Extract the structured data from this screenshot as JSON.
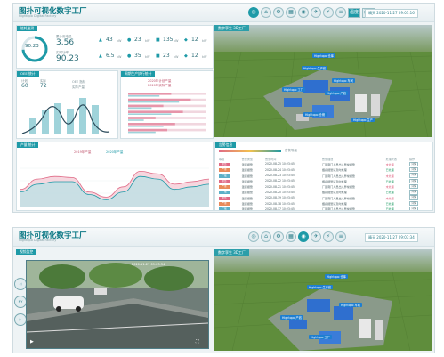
{
  "dashboard": {
    "title": "图扑可视化数字工厂",
    "subtitle": "Hightopo Digital Factory",
    "toolbar": [
      "◎",
      "⌂",
      "⚙",
      "▦",
      "◉",
      "✈",
      "⚡",
      "≡"
    ],
    "toolbar_extra": [
      "温度",
      "湿度"
    ],
    "weather": "晴天  2020-11-27 09:01:16",
    "panels": {
      "energy": {
        "title": "能耗监测",
        "total_label": "总功率/千瓦",
        "gauge_value": "90.23",
        "val1": "3.56",
        "val2": "90.23",
        "label1": "累计用电量",
        "label2": "实时功率",
        "stats": [
          {
            "icon": "▲",
            "value": "43",
            "unit": "kW"
          },
          {
            "icon": "●",
            "value": "23",
            "unit": "kW"
          },
          {
            "icon": "■",
            "value": "135",
            "unit": "kW"
          },
          {
            "icon": "◆",
            "value": "12",
            "unit": "kW"
          },
          {
            "icon": "▲",
            "value": "6.5",
            "unit": "kW"
          },
          {
            "icon": "●",
            "value": "35",
            "unit": "kW"
          },
          {
            "icon": "■",
            "value": "23",
            "unit": "kW"
          },
          {
            "icon": "◆",
            "value": "12",
            "unit": "kW"
          }
        ]
      },
      "oee": {
        "title": "OEE 统计",
        "v1": "60",
        "v2": "72",
        "l1": "计划",
        "l2": "实际",
        "legend": [
          "OEE 指标",
          "实际产量"
        ]
      },
      "production": {
        "title": "周期生产执行统计",
        "legend": [
          "2020年计划产量",
          "2020年实际产量"
        ],
        "bars": [
          0.55,
          0.8,
          0.45,
          0.7,
          0.35,
          0.6,
          0.5
        ]
      },
      "trend": {
        "title": "产量 统计",
        "legend": [
          "2019年产量",
          "2020年产量"
        ],
        "chart_data": {
          "type": "area",
          "series": [
            {
              "name": "2019年产量",
              "values": [
                0.35,
                0.55,
                0.6,
                0.58,
                0.3,
                0.2,
                0.4,
                0.7,
                0.65,
                0.45,
                0.5,
                0.55
              ]
            },
            {
              "name": "2020年产量",
              "values": [
                0.3,
                0.45,
                0.5,
                0.5,
                0.25,
                0.15,
                0.3,
                0.6,
                0.55,
                0.35,
                0.4,
                0.45
              ]
            }
          ]
        }
      },
      "map": {
        "title": "数字孪生 3D工厂",
        "tags": [
          "Hightopo 生产线",
          "Hightopo 仓库",
          "Hightopo 车间",
          "Hightopo 产线",
          "Hightopo 工厂",
          "Hightopo 仓储",
          "Hightopo 生产"
        ]
      },
      "events": {
        "title": "告警信息",
        "filter_label": "告警等级",
        "headers": [
          "等级",
          "告警类型",
          "告警时间",
          "告警描述",
          "处理状态",
          "操作"
        ],
        "rows": [
          {
            "level": "紧急",
            "type": "温度报警",
            "time": "2020-08-25 10:23:45",
            "desc": "厂区南门人员出入异常报警",
            "status": "未处理",
            "op": "详情"
          },
          {
            "level": "严重",
            "type": "温度报警",
            "time": "2020-08-24 10:23:45",
            "desc": "烟感报警请及时处理",
            "status": "已处理",
            "op": "详情"
          },
          {
            "level": "一般",
            "type": "温度报警",
            "time": "2020-08-23 10:23:45",
            "desc": "厂区南门人员出入异常报警",
            "status": "未处理",
            "op": "详情"
          },
          {
            "level": "紧急",
            "type": "温度报警",
            "time": "2020-08-22 10:23:45",
            "desc": "烟感报警请及时处理",
            "status": "已处理",
            "op": "详情"
          },
          {
            "level": "严重",
            "type": "温度报警",
            "time": "2020-08-21 10:23:45",
            "desc": "厂区南门人员出入异常报警",
            "status": "未处理",
            "op": "详情"
          },
          {
            "level": "一般",
            "type": "温度报警",
            "time": "2020-08-20 10:23:45",
            "desc": "烟感报警请及时处理",
            "status": "已处理",
            "op": "详情"
          },
          {
            "level": "紧急",
            "type": "温度报警",
            "time": "2020-08-19 10:23:45",
            "desc": "厂区南门人员出入异常报警",
            "status": "未处理",
            "op": "详情"
          },
          {
            "level": "严重",
            "type": "温度报警",
            "time": "2020-08-18 10:23:45",
            "desc": "烟感报警请及时处理",
            "status": "已处理",
            "op": "详情"
          },
          {
            "level": "一般",
            "type": "温度报警",
            "time": "2020-08-17 10:23:45",
            "desc": "厂区南门人员出入异常报警",
            "status": "已处理",
            "op": "详情"
          }
        ]
      }
    }
  },
  "surveillance": {
    "title": "图扑可视化数字工厂",
    "subtitle": "Hightopo Digital Factory",
    "weather": "晴天  2020-11-27 09:03:34",
    "video_title": "视频监控",
    "video_timestamp": "2020-11-27 09:03:34",
    "side_controls": [
      "◁",
      "NY",
      "▷"
    ],
    "map_title": "数字孪生 3D工厂",
    "tags": [
      "Hightopo 生产线",
      "Hightopo 仓库",
      "Hightopo 车间",
      "Hightopo 产线",
      "Hightopo 工厂"
    ]
  }
}
